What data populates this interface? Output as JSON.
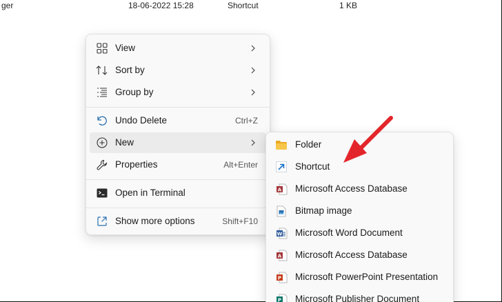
{
  "file_row": {
    "name": "ger",
    "date": "18-06-2022 15:28",
    "type": "Shortcut",
    "size": "1 KB"
  },
  "context_menu": {
    "items": [
      {
        "label": "View",
        "icon": "view-grid-icon",
        "has_submenu": true
      },
      {
        "label": "Sort by",
        "icon": "sort-icon",
        "has_submenu": true
      },
      {
        "label": "Group by",
        "icon": "group-list-icon",
        "has_submenu": true
      },
      {
        "label": "Undo Delete",
        "icon": "undo-icon",
        "shortcut": "Ctrl+Z"
      },
      {
        "label": "New",
        "icon": "plus-circle-icon",
        "has_submenu": true,
        "highlighted": true
      },
      {
        "label": "Properties",
        "icon": "wrench-icon",
        "shortcut": "Alt+Enter"
      },
      {
        "label": "Open in Terminal",
        "icon": "terminal-icon"
      },
      {
        "label": "Show more options",
        "icon": "share-expand-icon",
        "shortcut": "Shift+F10"
      }
    ]
  },
  "new_submenu": {
    "items": [
      {
        "label": "Folder",
        "icon": "folder-icon"
      },
      {
        "label": "Shortcut",
        "icon": "shortcut-arrow-icon"
      },
      {
        "label": "Microsoft Access Database",
        "icon": "access-file-icon"
      },
      {
        "label": "Bitmap image",
        "icon": "bitmap-file-icon"
      },
      {
        "label": "Microsoft Word Document",
        "icon": "word-file-icon"
      },
      {
        "label": "Microsoft Access Database",
        "icon": "access-file-icon"
      },
      {
        "label": "Microsoft PowerPoint Presentation",
        "icon": "powerpoint-file-icon"
      },
      {
        "label": "Microsoft Publisher Document",
        "icon": "publisher-file-icon"
      }
    ]
  },
  "colors": {
    "annotation_arrow": "#e3262b",
    "menu_background": "#f9f9f9",
    "hover_background": "#ebebeb",
    "folder_yellow": "#f7c64a",
    "word_blue": "#2b5797",
    "access_red": "#a4373a",
    "powerpoint_orange": "#c43e1c",
    "publisher_teal": "#077568",
    "shortcut_blue": "#1a73c8"
  }
}
